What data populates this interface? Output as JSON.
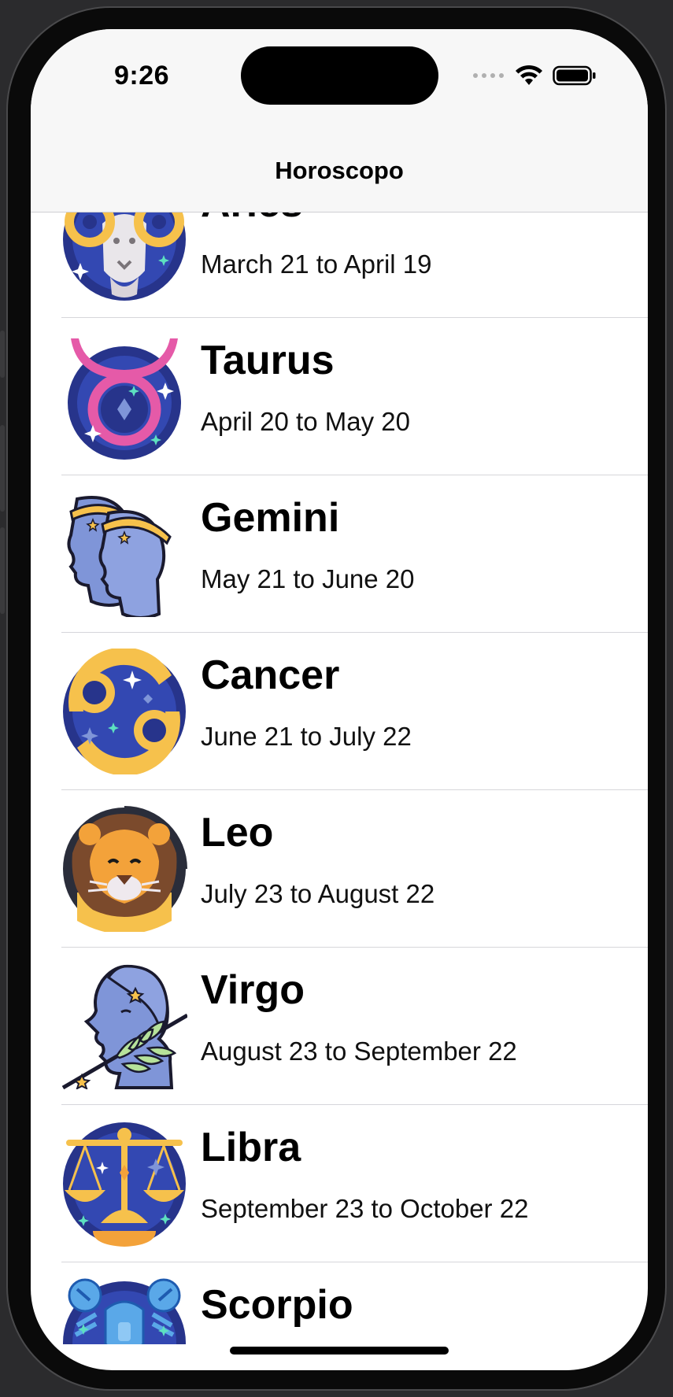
{
  "status_bar": {
    "time": "9:26"
  },
  "nav": {
    "title": "Horoscopo"
  },
  "signs": [
    {
      "name": "Aries",
      "dates": "March 21 to April 19",
      "icon": "aries-icon"
    },
    {
      "name": "Taurus",
      "dates": "April 20 to May 20",
      "icon": "taurus-icon"
    },
    {
      "name": "Gemini",
      "dates": "May 21 to June 20",
      "icon": "gemini-icon"
    },
    {
      "name": "Cancer",
      "dates": "June 21 to July 22",
      "icon": "cancer-icon"
    },
    {
      "name": "Leo",
      "dates": "July 23 to August 22",
      "icon": "leo-icon"
    },
    {
      "name": "Virgo",
      "dates": "August 23 to September 22",
      "icon": "virgo-icon"
    },
    {
      "name": "Libra",
      "dates": "September 23 to October 22",
      "icon": "libra-icon"
    },
    {
      "name": "Scorpio",
      "dates": "",
      "icon": "scorpio-icon"
    }
  ],
  "colors": {
    "navy": "#27348b",
    "yellow": "#f6c14c",
    "pink": "#e55aa8",
    "blue_figure": "#7f95d8",
    "lion_orange": "#f3a23a"
  }
}
